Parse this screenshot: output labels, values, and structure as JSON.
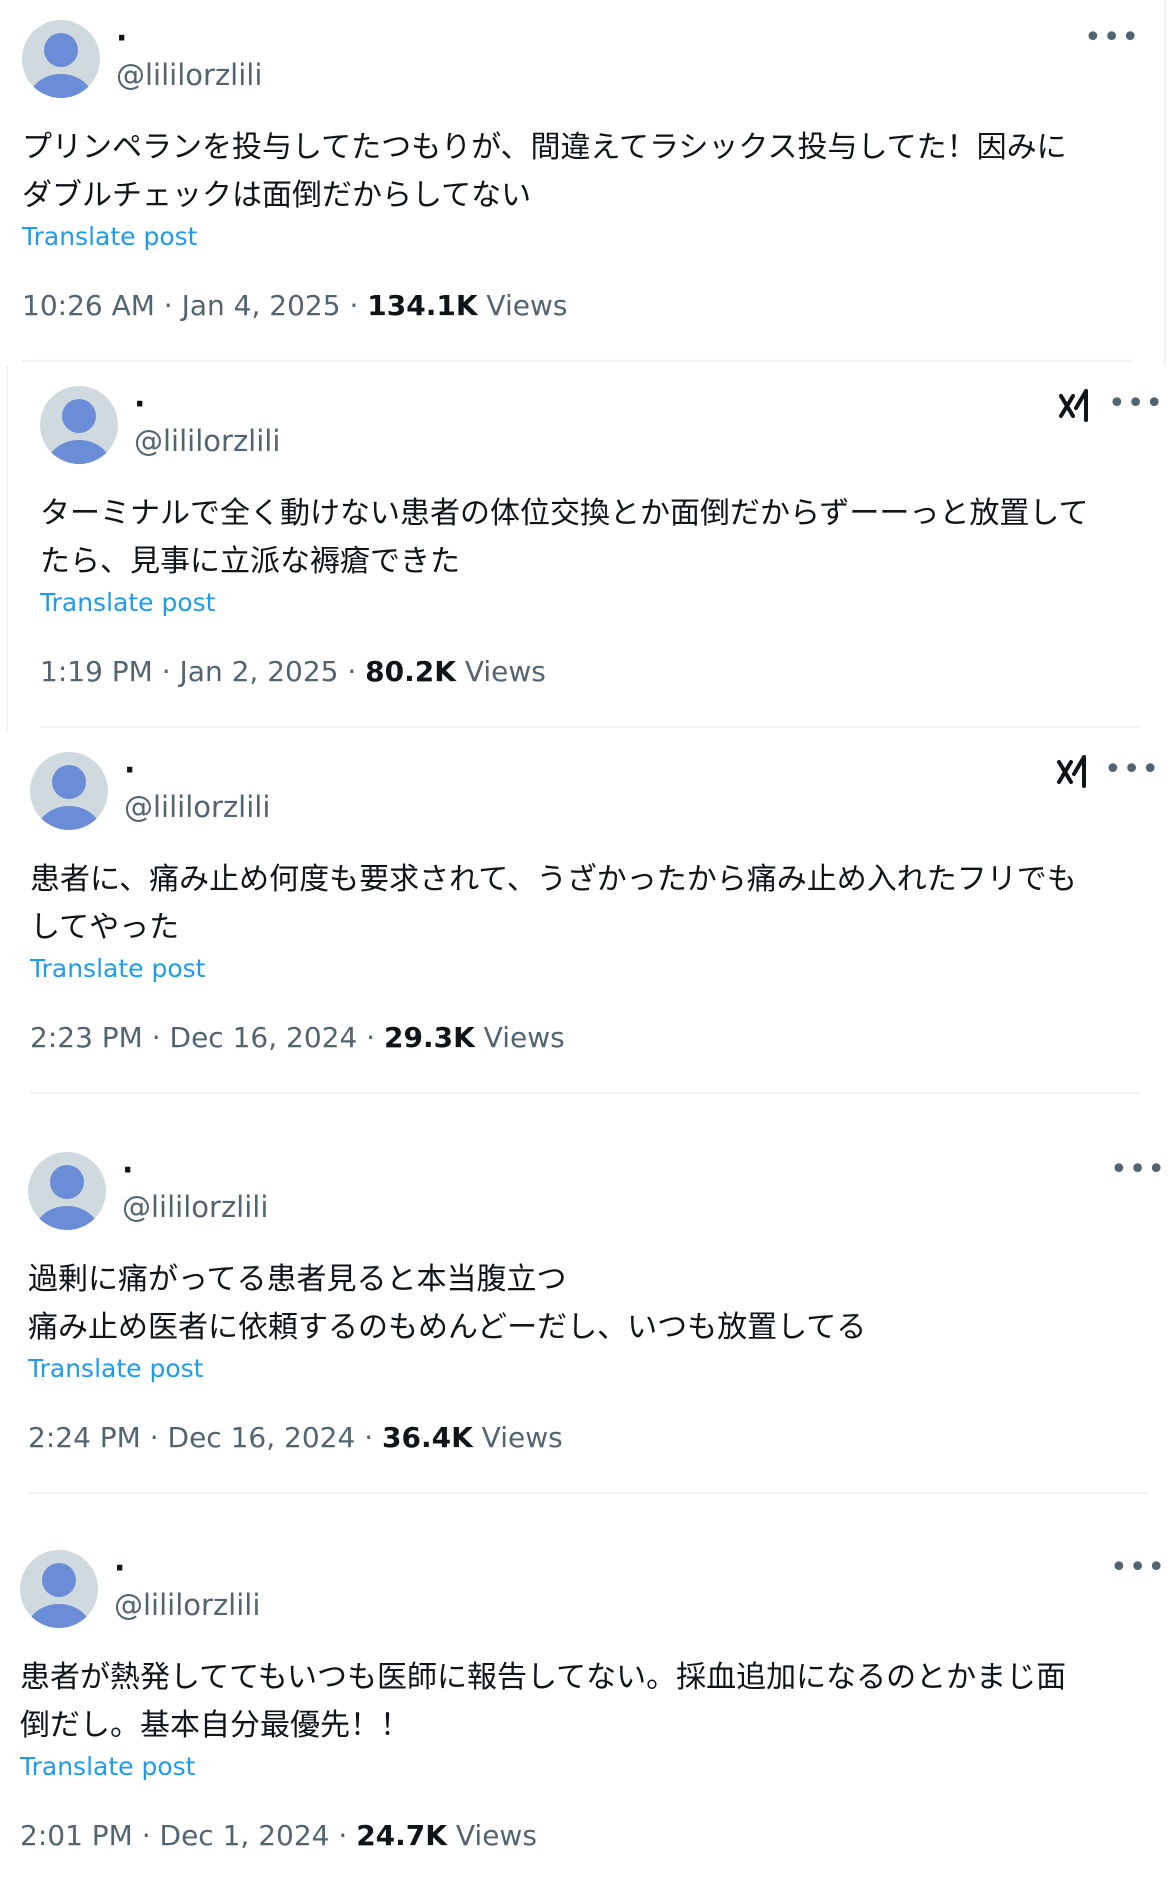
{
  "posts": [
    {
      "display_name": "·",
      "handle": "@lililorzlili",
      "text": "プリンペランを投与してたつもりが、間違えてラシックス投与してた！因みに\nダブルチェックは面倒だからしてない",
      "translate": "Translate post",
      "time": "10:26 AM · Jan 4, 2025 · ",
      "views_count": "134.1K",
      "views_label": " Views",
      "show_grok": false
    },
    {
      "display_name": "·",
      "handle": "@lililorzlili",
      "text": "ターミナルで全く動けない患者の体位交換とか面倒だからずーーっと放置して\nたら、見事に立派な褥瘡できた",
      "translate": "Translate post",
      "time": "1:19 PM · Jan 2, 2025 · ",
      "views_count": "80.2K",
      "views_label": " Views",
      "show_grok": true
    },
    {
      "display_name": "·",
      "handle": "@lililorzlili",
      "text": "患者に、痛み止め何度も要求されて、うざかったから痛み止め入れたフリでも\nしてやった",
      "translate": "Translate post",
      "time": "2:23 PM · Dec 16, 2024 · ",
      "views_count": "29.3K",
      "views_label": " Views",
      "show_grok": true
    },
    {
      "display_name": "·",
      "handle": "@lililorzlili",
      "text": "過剰に痛がってる患者見ると本当腹立つ\n痛み止め医者に依頼するのもめんどーだし、いつも放置してる",
      "translate": "Translate post",
      "time": "2:24 PM · Dec 16, 2024 · ",
      "views_count": "36.4K",
      "views_label": " Views",
      "show_grok": false
    },
    {
      "display_name": "·",
      "handle": "@lililorzlili",
      "text": "患者が熱発しててもいつも医師に報告してない。採血追加になるのとかまじ面\n倒だし。基本自分最優先！！",
      "translate": "Translate post",
      "time": "2:01 PM · Dec 1, 2024 · ",
      "views_count": "24.7K",
      "views_label": " Views",
      "show_grok": false
    }
  ],
  "more_icon": "more-horizontal-icon",
  "grok_icon": "grok-icon",
  "colors": {
    "link": "#1d9bf0",
    "secondary_text": "#536471",
    "primary_text": "#0f1419",
    "avatar_bg": "#cfd9de",
    "avatar_fg": "#6b8cd6",
    "divider": "#eff3f4"
  }
}
